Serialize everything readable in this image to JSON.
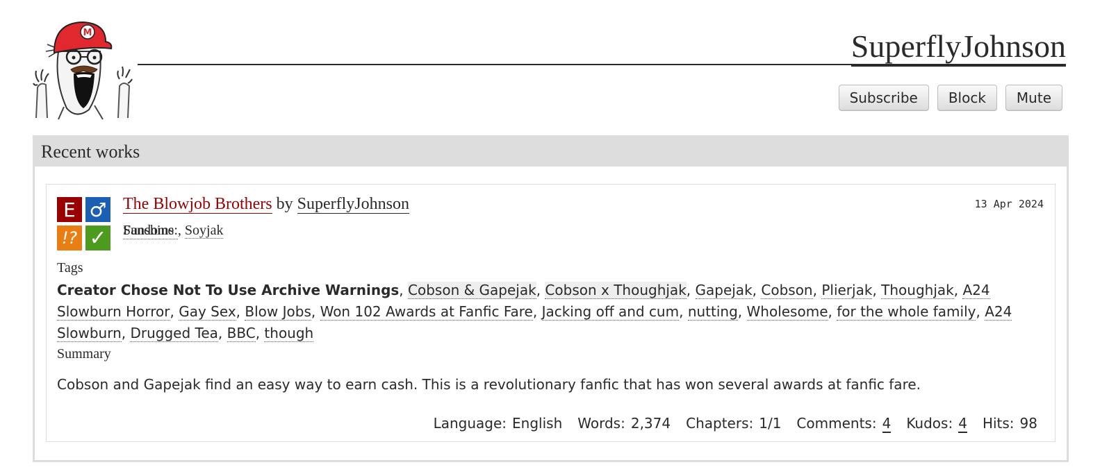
{
  "header": {
    "username": "SuperflyJohnson",
    "buttons": {
      "subscribe": "Subscribe",
      "block": "Block",
      "mute": "Mute"
    }
  },
  "works": {
    "heading": "Recent works",
    "item": {
      "title": "The Blowjob Brothers",
      "by": "by",
      "author": "SuperflyJohnson",
      "date": "13 Apr 2024",
      "required_tags": {
        "rating": "E",
        "category": "♂",
        "warning": "!?",
        "complete": "✓"
      },
      "fandoms": {
        "overlap_a": "Fandoms:",
        "overlap_b": "Sunshine",
        "sep": ", ",
        "second": "Soyjak"
      },
      "tags_heading": "Tags",
      "tags": [
        {
          "text": "Creator Chose Not To Use Archive Warnings",
          "kind": "warning"
        },
        {
          "text": "Cobson & Gapejak",
          "kind": "rel"
        },
        {
          "text": "Cobson x Thoughjak",
          "kind": "rel"
        },
        {
          "text": "Gapejak",
          "kind": "char"
        },
        {
          "text": "Cobson",
          "kind": "char"
        },
        {
          "text": "Plierjak",
          "kind": "char"
        },
        {
          "text": "Thoughjak",
          "kind": "char"
        },
        {
          "text": "A24 Slowburn Horror",
          "kind": "free"
        },
        {
          "text": "Gay Sex",
          "kind": "free"
        },
        {
          "text": "Blow Jobs",
          "kind": "free"
        },
        {
          "text": "Won 102 Awards at Fanfic Fare",
          "kind": "free"
        },
        {
          "text": "Jacking off and cum",
          "kind": "free"
        },
        {
          "text": "nutting",
          "kind": "free"
        },
        {
          "text": "Wholesome",
          "kind": "free"
        },
        {
          "text": "for the whole family",
          "kind": "free"
        },
        {
          "text": "A24 Slowburn",
          "kind": "free"
        },
        {
          "text": "Drugged Tea",
          "kind": "free"
        },
        {
          "text": "BBC",
          "kind": "free"
        },
        {
          "text": "though",
          "kind": "free"
        }
      ],
      "summary_heading": "Summary",
      "summary": "Cobson and Gapejak find an easy way to earn cash. This is a revolutionary fanfic that has won several awards at fanfic fare.",
      "stats": {
        "language_label": "Language:",
        "language": "English",
        "words_label": "Words:",
        "words": "2,374",
        "chapters_label": "Chapters:",
        "chapters": "1/1",
        "comments_label": "Comments:",
        "comments": "4",
        "kudos_label": "Kudos:",
        "kudos": "4",
        "hits_label": "Hits:",
        "hits": "98"
      }
    }
  },
  "colors": {
    "rating": "#990000",
    "category": "#1a5fb4",
    "warning": "#e87e14",
    "complete": "#4c9a1e",
    "title_link": "#990000",
    "panel_header": "#dddddd"
  },
  "icons": {
    "avatar": "soyjak-mario-cap-avatar",
    "rating": "explicit-rating-icon",
    "category": "male-symbol-icon",
    "warning": "warning-icon",
    "complete": "checkmark-icon"
  }
}
